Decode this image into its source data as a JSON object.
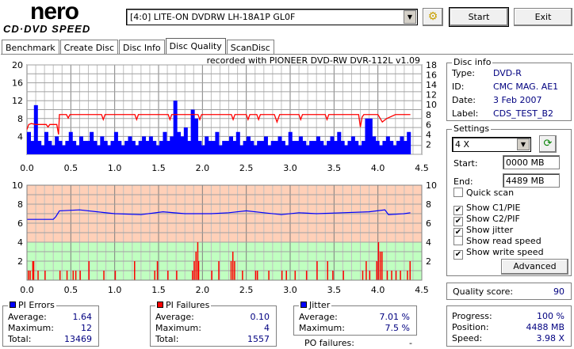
{
  "app": {
    "logo_top": "nero",
    "logo_bottom": "CD·DVD SPEED"
  },
  "toolbar": {
    "drive": "[4:0]  LITE-ON DVDRW LH-18A1P GL0F",
    "start": "Start",
    "exit": "Exit",
    "drive_icon": "drive-config-icon"
  },
  "tabs": [
    "Benchmark",
    "Create Disc",
    "Disc Info",
    "Disc Quality",
    "ScanDisc"
  ],
  "active_tab": "Disc Quality",
  "recorded_with": "recorded with PIONEER DVD-RW  DVR-112L v1.09",
  "disc_info": {
    "title": "Disc info",
    "rows": [
      {
        "label": "Type:",
        "value": "DVD-R"
      },
      {
        "label": "ID:",
        "value": "CMC MAG. AE1"
      },
      {
        "label": "Date:",
        "value": "3 Feb 2007"
      },
      {
        "label": "Label:",
        "value": "CDS_TEST_B2"
      }
    ]
  },
  "settings": {
    "title": "Settings",
    "speed": "4 X",
    "start_label": "Start:",
    "start": "0000 MB",
    "end_label": "End:",
    "end": "4489 MB",
    "checks": [
      {
        "label": "Quick scan",
        "checked": false
      },
      {
        "label": "Show C1/PIE",
        "checked": true
      },
      {
        "label": "Show C2/PIF",
        "checked": true
      },
      {
        "label": "Show jitter",
        "checked": true
      },
      {
        "label": "Show read speed",
        "checked": false
      },
      {
        "label": "Show write speed",
        "checked": true
      }
    ],
    "advanced": "Advanced"
  },
  "quality": {
    "label": "Quality score:",
    "value": "90"
  },
  "pi_errors": {
    "title": "PI Errors",
    "color": "#0000ff",
    "rows": [
      {
        "label": "Average:",
        "value": "1.64"
      },
      {
        "label": "Maximum:",
        "value": "12"
      },
      {
        "label": "Total:",
        "value": "13469"
      }
    ]
  },
  "pi_failures": {
    "title": "PI Failures",
    "color": "#ff0000",
    "rows": [
      {
        "label": "Average:",
        "value": "0.10"
      },
      {
        "label": "Maximum:",
        "value": "4"
      },
      {
        "label": "Total:",
        "value": "1557"
      }
    ]
  },
  "jitter": {
    "title": "Jitter",
    "color": "#0000ff",
    "rows": [
      {
        "label": "Average:",
        "value": "7.01 %"
      },
      {
        "label": "Maximum:",
        "value": "7.5 %"
      }
    ]
  },
  "po_failures": {
    "label": "PO failures:",
    "value": "-"
  },
  "progress": {
    "rows": [
      {
        "label": "Progress:",
        "value": "100 %"
      },
      {
        "label": "Position:",
        "value": "4488 MB"
      },
      {
        "label": "Speed:",
        "value": "3.98 X"
      }
    ]
  },
  "chart_data": [
    {
      "type": "bar",
      "name": "PI Errors / write speed",
      "xlim": [
        0,
        4.5
      ],
      "ylim_left": [
        0,
        20
      ],
      "ylim_right": [
        0,
        18
      ],
      "x_ticks": [
        "0.0",
        "0.5",
        "1.0",
        "1.5",
        "2.0",
        "2.5",
        "3.0",
        "3.5",
        "4.0",
        "4.5"
      ],
      "y_ticks_left": [
        "20",
        "16",
        "12",
        "8",
        "4"
      ],
      "y_ticks_right": [
        "18",
        "16",
        "14",
        "12",
        "10",
        "8",
        "6",
        "4",
        "2"
      ],
      "pie_x_end": 4.37,
      "pie": [
        5,
        3,
        11,
        3,
        2,
        5,
        3,
        2,
        4,
        3,
        2,
        3,
        5,
        3,
        2,
        4,
        3,
        3,
        5,
        3,
        2,
        4,
        3,
        2,
        3,
        5,
        3,
        2,
        3,
        4,
        3,
        2,
        3,
        4,
        3,
        4,
        3,
        2,
        3,
        5,
        3,
        4,
        12,
        5,
        4,
        6,
        3,
        10,
        8,
        3,
        2,
        4,
        3,
        3,
        5,
        2,
        3,
        3,
        4,
        3,
        5,
        2,
        3,
        4,
        3,
        2,
        3,
        3,
        4,
        2,
        3,
        3,
        4,
        3,
        2,
        5,
        3,
        3,
        4,
        3,
        2,
        3,
        3,
        4,
        3,
        2,
        3,
        4,
        3,
        5,
        3,
        2,
        3,
        4,
        3,
        2,
        3,
        8,
        8,
        4,
        3,
        2,
        3,
        4,
        3,
        2,
        3,
        4,
        3,
        5
      ],
      "write_speed": [
        [
          0,
          5
        ],
        [
          0.02,
          6
        ],
        [
          0.05,
          6.2
        ],
        [
          0.1,
          6
        ],
        [
          0.22,
          6
        ],
        [
          0.24,
          5.5
        ],
        [
          0.26,
          6
        ],
        [
          0.34,
          6
        ],
        [
          0.36,
          4
        ],
        [
          0.37,
          8
        ],
        [
          0.45,
          8
        ],
        [
          0.47,
          7.3
        ],
        [
          0.49,
          8
        ],
        [
          0.85,
          8
        ],
        [
          0.87,
          7
        ],
        [
          0.89,
          8
        ],
        [
          1.23,
          8
        ],
        [
          1.25,
          7
        ],
        [
          1.27,
          8
        ],
        [
          1.61,
          8
        ],
        [
          1.63,
          7
        ],
        [
          1.65,
          8
        ],
        [
          1.95,
          8
        ],
        [
          1.97,
          7
        ],
        [
          1.99,
          8
        ],
        [
          2.33,
          8
        ],
        [
          2.35,
          7
        ],
        [
          2.37,
          8
        ],
        [
          2.5,
          8
        ],
        [
          2.52,
          7
        ],
        [
          2.54,
          8
        ],
        [
          2.62,
          8
        ],
        [
          2.64,
          7
        ],
        [
          2.66,
          8
        ],
        [
          2.82,
          8
        ],
        [
          2.85,
          6.5
        ],
        [
          2.88,
          8
        ],
        [
          3.0,
          8
        ],
        [
          3.1,
          8
        ],
        [
          3.12,
          7
        ],
        [
          3.14,
          8
        ],
        [
          3.4,
          8
        ],
        [
          3.42,
          7
        ],
        [
          3.44,
          8
        ],
        [
          3.78,
          8
        ],
        [
          3.8,
          5.5
        ],
        [
          3.82,
          7.5
        ],
        [
          3.84,
          8
        ],
        [
          4.0,
          8
        ],
        [
          4.05,
          6.5
        ],
        [
          4.1,
          7.2
        ],
        [
          4.2,
          8
        ],
        [
          4.37,
          8
        ]
      ]
    },
    {
      "type": "bar",
      "name": "PI Failures / jitter",
      "xlim": [
        0,
        4.5
      ],
      "ylim": [
        0,
        10
      ],
      "x_ticks": [
        "0.0",
        "0.5",
        "1.0",
        "1.5",
        "2.0",
        "2.5",
        "3.0",
        "3.5",
        "4.0",
        "4.5"
      ],
      "y_ticks_left": [
        "10",
        "8",
        "6",
        "4",
        "2"
      ],
      "y_ticks_right": [
        "10",
        "8",
        "6",
        "4",
        "2"
      ],
      "jitter": [
        [
          0,
          6.4
        ],
        [
          0.3,
          6.4
        ],
        [
          0.33,
          6.7
        ],
        [
          0.37,
          7.3
        ],
        [
          0.6,
          7.4
        ],
        [
          0.8,
          7.2
        ],
        [
          1.0,
          7.0
        ],
        [
          1.3,
          6.9
        ],
        [
          1.55,
          7.2
        ],
        [
          1.8,
          7.0
        ],
        [
          2.1,
          7.0
        ],
        [
          2.3,
          7.1
        ],
        [
          2.5,
          7.3
        ],
        [
          2.7,
          7.1
        ],
        [
          2.9,
          6.9
        ],
        [
          3.1,
          7.1
        ],
        [
          3.3,
          7.0
        ],
        [
          3.6,
          7.1
        ],
        [
          3.9,
          7.2
        ],
        [
          4.08,
          7.4
        ],
        [
          4.12,
          6.9
        ],
        [
          4.3,
          7.0
        ],
        [
          4.37,
          7.1
        ]
      ],
      "pif": [
        [
          0.01,
          1
        ],
        [
          0.03,
          1
        ],
        [
          0.06,
          2
        ],
        [
          0.07,
          2
        ],
        [
          0.12,
          1
        ],
        [
          0.2,
          1
        ],
        [
          0.37,
          1
        ],
        [
          0.45,
          1
        ],
        [
          0.52,
          1
        ],
        [
          0.55,
          1
        ],
        [
          0.6,
          1
        ],
        [
          0.7,
          2
        ],
        [
          0.87,
          1
        ],
        [
          1.0,
          1
        ],
        [
          1.22,
          2
        ],
        [
          1.45,
          1
        ],
        [
          1.48,
          2
        ],
        [
          1.6,
          1
        ],
        [
          1.7,
          1
        ],
        [
          1.88,
          1
        ],
        [
          1.9,
          2
        ],
        [
          1.92,
          3
        ],
        [
          1.94,
          4
        ],
        [
          1.95,
          2
        ],
        [
          2.1,
          1
        ],
        [
          2.18,
          2
        ],
        [
          2.32,
          2
        ],
        [
          2.34,
          3
        ],
        [
          2.36,
          2
        ],
        [
          2.45,
          1
        ],
        [
          2.6,
          1
        ],
        [
          2.62,
          1
        ],
        [
          2.75,
          1
        ],
        [
          2.9,
          1
        ],
        [
          2.95,
          1
        ],
        [
          3.05,
          1
        ],
        [
          3.18,
          1
        ],
        [
          3.3,
          2
        ],
        [
          3.42,
          2
        ],
        [
          3.48,
          1
        ],
        [
          3.6,
          1
        ],
        [
          3.82,
          1
        ],
        [
          3.86,
          2
        ],
        [
          3.9,
          1
        ],
        [
          3.98,
          2
        ],
        [
          4.0,
          4
        ],
        [
          4.02,
          3
        ],
        [
          4.04,
          3
        ],
        [
          4.1,
          1
        ],
        [
          4.15,
          1
        ],
        [
          4.2,
          1
        ],
        [
          4.25,
          1
        ],
        [
          4.33,
          1
        ],
        [
          4.36,
          2
        ]
      ]
    }
  ]
}
